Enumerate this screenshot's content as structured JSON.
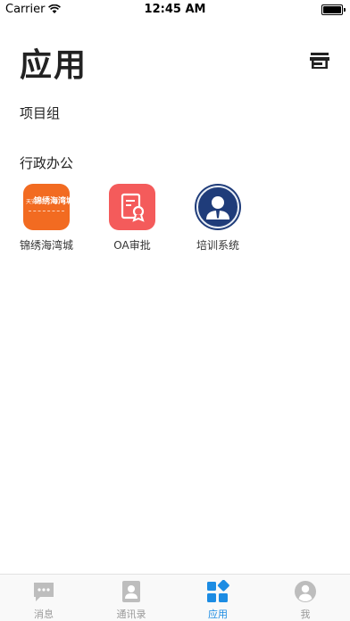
{
  "status_bar": {
    "carrier": "Carrier",
    "time": "12:45 AM"
  },
  "header": {
    "title": "应用",
    "store_icon": "store-icon"
  },
  "sections": {
    "project_group": "项目组",
    "admin": "行政办公"
  },
  "apps": [
    {
      "name": "锦绣海湾城",
      "icon": "jinxiu-logo-icon",
      "logo_text": "锦绣海湾城",
      "logo_prefix": "天安",
      "color": "#f26b21"
    },
    {
      "name": "OA审批",
      "icon": "oa-approval-icon",
      "color": "#f45b5b"
    },
    {
      "name": "培训系统",
      "icon": "training-avatar-icon",
      "color": "#1f3c7a"
    }
  ],
  "tabs": [
    {
      "label": "消息",
      "icon": "message-icon",
      "active": false
    },
    {
      "label": "通讯录",
      "icon": "contacts-icon",
      "active": false
    },
    {
      "label": "应用",
      "icon": "apps-icon",
      "active": true
    },
    {
      "label": "我",
      "icon": "profile-icon",
      "active": false
    }
  ],
  "colors": {
    "accent": "#1c8ce3",
    "inactive": "#bdbdbd"
  }
}
